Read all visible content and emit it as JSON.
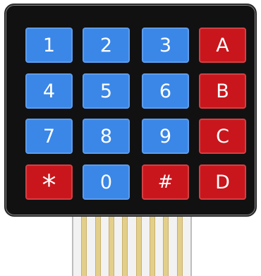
{
  "keypad": {
    "rows": [
      [
        {
          "label": "1",
          "color": "#3a87e8"
        },
        {
          "label": "2",
          "color": "#3a87e8"
        },
        {
          "label": "3",
          "color": "#3a87e8"
        },
        {
          "label": "A",
          "color": "#c9161c"
        }
      ],
      [
        {
          "label": "4",
          "color": "#3a87e8"
        },
        {
          "label": "5",
          "color": "#3a87e8"
        },
        {
          "label": "6",
          "color": "#3a87e8"
        },
        {
          "label": "B",
          "color": "#c9161c"
        }
      ],
      [
        {
          "label": "7",
          "color": "#3a87e8"
        },
        {
          "label": "8",
          "color": "#3a87e8"
        },
        {
          "label": "9",
          "color": "#3a87e8"
        },
        {
          "label": "C",
          "color": "#c9161c"
        }
      ],
      [
        {
          "label": "*",
          "color": "#c9161c"
        },
        {
          "label": "0",
          "color": "#3a87e8"
        },
        {
          "label": "#",
          "color": "#c9161c"
        },
        {
          "label": "D",
          "color": "#c9161c"
        }
      ]
    ],
    "body_color": "#111111",
    "ribbon_color": "#f2f2f2",
    "pin_color": "#e3cf8a",
    "pin_count": 8
  }
}
